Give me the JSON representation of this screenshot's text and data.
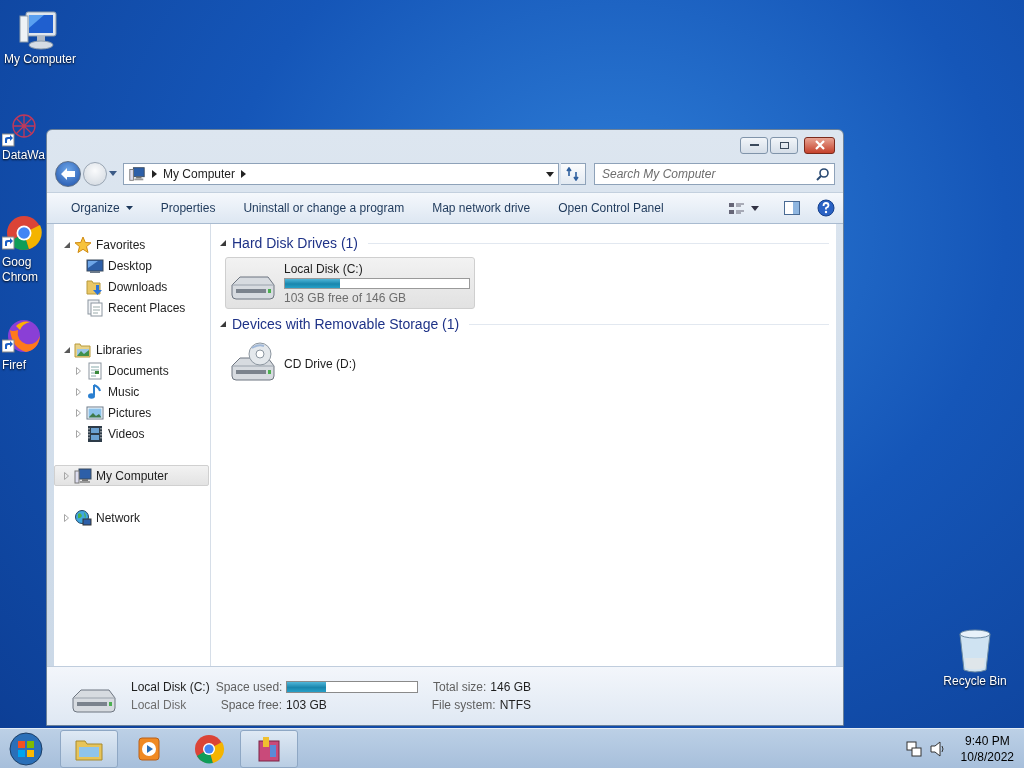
{
  "desktop_icons": [
    {
      "kind": "computer",
      "label_lines": [
        "My Computer"
      ]
    },
    {
      "kind": "app",
      "label_lines": [
        "DataWa"
      ]
    },
    {
      "kind": "chrome",
      "label_lines": [
        "Goog",
        "Chrom"
      ]
    },
    {
      "kind": "firefox",
      "label_lines": [
        "Firef"
      ]
    },
    {
      "kind": "recycle",
      "label_lines": [
        "Recycle Bin"
      ]
    }
  ],
  "window": {
    "address": {
      "segments": [
        "My Computer"
      ]
    },
    "search": {
      "placeholder": "Search My Computer"
    },
    "commands": [
      {
        "label": "Organize",
        "menu": true
      },
      {
        "label": "Properties",
        "menu": false
      },
      {
        "label": "Uninstall or change a program",
        "menu": false
      },
      {
        "label": "Map network drive",
        "menu": false
      },
      {
        "label": "Open Control Panel",
        "menu": false
      }
    ],
    "navigation": [
      {
        "kind": "favorites",
        "label": "Favorites",
        "expanded": true,
        "selected": false,
        "children": [
          {
            "kind": "desktop",
            "label": "Desktop",
            "selected": false
          },
          {
            "kind": "downloads",
            "label": "Downloads",
            "selected": false
          },
          {
            "kind": "recent",
            "label": "Recent Places",
            "selected": false
          }
        ]
      },
      {
        "kind": "libraries",
        "label": "Libraries",
        "expanded": true,
        "selected": false,
        "children": [
          {
            "kind": "documents",
            "label": "Documents",
            "expanded": false,
            "selected": false
          },
          {
            "kind": "music",
            "label": "Music",
            "expanded": false,
            "selected": false
          },
          {
            "kind": "pictures",
            "label": "Pictures",
            "expanded": false,
            "selected": false
          },
          {
            "kind": "videos",
            "label": "Videos",
            "expanded": false,
            "selected": false
          }
        ]
      },
      {
        "kind": "computer",
        "label": "My Computer",
        "expanded": false,
        "selected": true
      },
      {
        "kind": "network",
        "label": "Network",
        "expanded": false,
        "selected": false
      }
    ],
    "groups": [
      {
        "title": "Hard Disk Drives (1)",
        "expanded": true,
        "items": [
          {
            "kind": "disk",
            "name": "Local Disk (C:)",
            "level": 0.3,
            "caption": "103 GB free of 146 GB",
            "selected": true
          }
        ]
      },
      {
        "title": "Devices with Removable Storage (1)",
        "expanded": true,
        "items": [
          {
            "kind": "cd",
            "name": "CD Drive (D:)",
            "selected": false
          }
        ]
      }
    ],
    "details": {
      "name": "Local Disk (C:)",
      "type": "Local Disk",
      "fields": [
        {
          "kind": "bar",
          "label": "Space used:",
          "level": 0.3
        },
        {
          "kind": "text",
          "label": "Total size:",
          "value": "146 GB"
        },
        {
          "kind": "text",
          "label": "Space free:",
          "value": "103 GB"
        },
        {
          "kind": "text",
          "label": "File system:",
          "value": "NTFS"
        }
      ]
    }
  },
  "taskbar": {
    "buttons": [
      {
        "kind": "explorer",
        "selected": true
      },
      {
        "kind": "media",
        "selected": false
      },
      {
        "kind": "chrome",
        "selected": false
      },
      {
        "kind": "app",
        "selected": true
      }
    ],
    "time": "9:40 PM",
    "date": "10/8/2022"
  }
}
